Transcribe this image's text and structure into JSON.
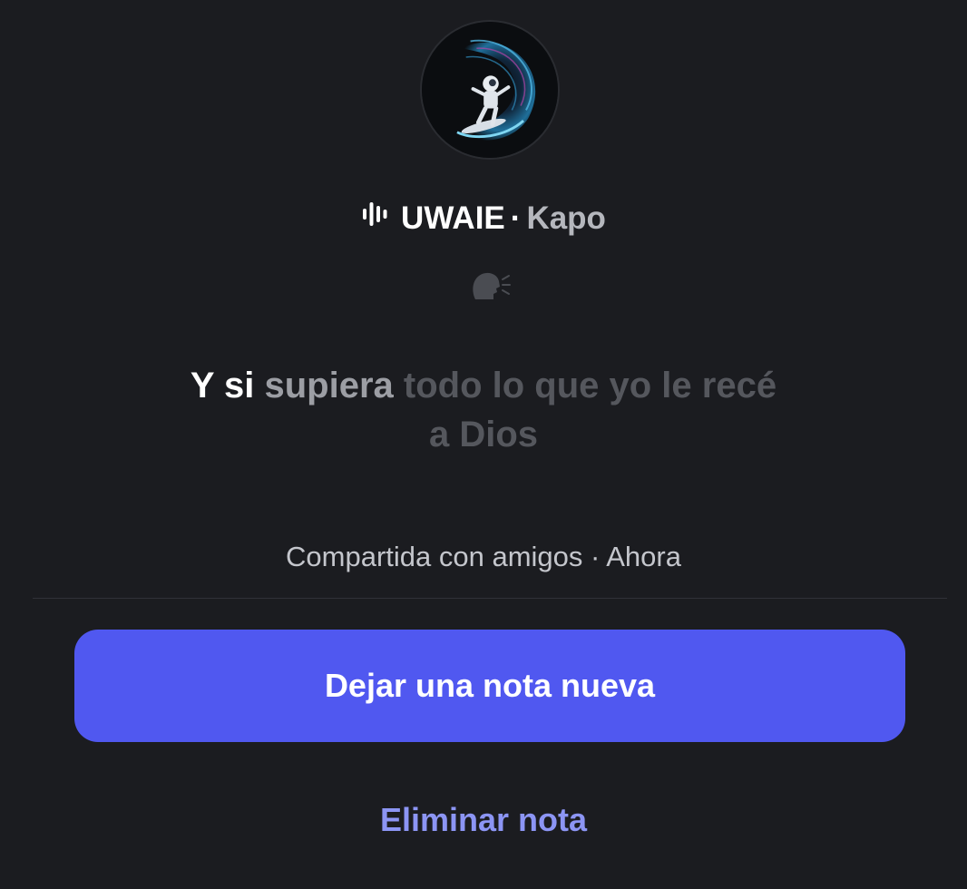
{
  "profile": {
    "avatar_icon": "astronaut-surfing-wave-avatar"
  },
  "song": {
    "icon": "audio-bars-icon",
    "title": "UWAIE",
    "separator": "·",
    "artist": "Kapo"
  },
  "reaction": {
    "icon": "speaking-head-icon"
  },
  "lyric": {
    "active": "Y si",
    "mid": "supiera",
    "dim_line1": "todo lo que yo le recé",
    "dim_line2": "a Dios"
  },
  "meta": {
    "shared_text": "Compartida con amigos · Ahora"
  },
  "actions": {
    "new_note_label": "Dejar una nota nueva",
    "delete_label": "Eliminar nota"
  },
  "colors": {
    "background": "#1b1c20",
    "primary_button": "#5058f0",
    "link": "#8c95f4"
  }
}
